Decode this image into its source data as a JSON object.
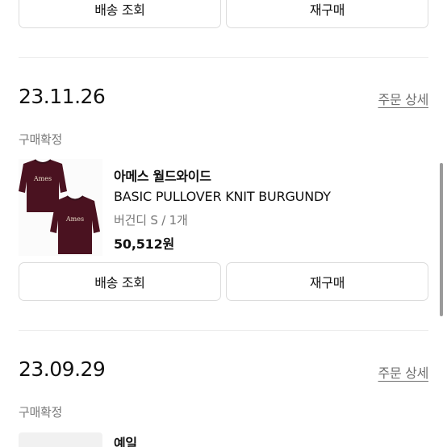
{
  "top_actions": {
    "delivery_label": "배송 조회",
    "reorder_label": "재구매"
  },
  "orders": [
    {
      "date": "23.11.26",
      "detail_link": "주문 상세",
      "status": "구매확정",
      "product": {
        "brand": "아메스 월드와이드",
        "name": "BASIC PULLOVER KNIT BURGUNDY",
        "option": "버건디 S / 1개",
        "price": "50,512원",
        "image_text": "Ames"
      },
      "delivery_label": "배송 조회",
      "reorder_label": "재구매"
    },
    {
      "date": "23.09.29",
      "detail_link": "주문 상세",
      "status": "구매확정",
      "product": {
        "brand": "예일"
      }
    }
  ],
  "colors": {
    "sweater": "#4a1220",
    "sweater_shadow": "#36101a",
    "link_gray": "#6f6f6f",
    "border": "#dcdcdc"
  }
}
